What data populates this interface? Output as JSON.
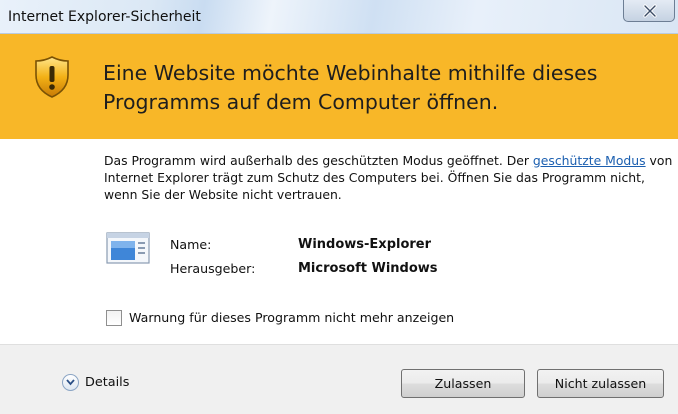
{
  "window": {
    "title": "Internet Explorer-Sicherheit"
  },
  "header": {
    "message": "Eine Website möchte Webinhalte mithilfe dieses Programms auf dem Computer öffnen.",
    "icon": "warning-shield-icon",
    "background_color": "#f8b728"
  },
  "body": {
    "text_part1": "Das Programm wird außerhalb des geschützten Modus geöffnet. Der ",
    "link_text": "geschützte Modus",
    "text_part2": " von Internet Explorer trägt zum Schutz des Computers bei. Öffnen Sie das Programm nicht, wenn Sie der Website nicht vertrauen.",
    "link_color": "#1b5fb0"
  },
  "program": {
    "icon": "windows-explorer-icon",
    "name_label": "Name:",
    "name_value": "Windows-Explorer",
    "publisher_label": "Herausgeber:",
    "publisher_value": "Microsoft Windows"
  },
  "options": {
    "dont_warn_label": "Warnung für dieses Programm nicht mehr anzeigen",
    "dont_warn_checked": false
  },
  "footer": {
    "details_label": "Details",
    "allow_label": "Zulassen",
    "deny_label": "Nicht zulassen"
  }
}
